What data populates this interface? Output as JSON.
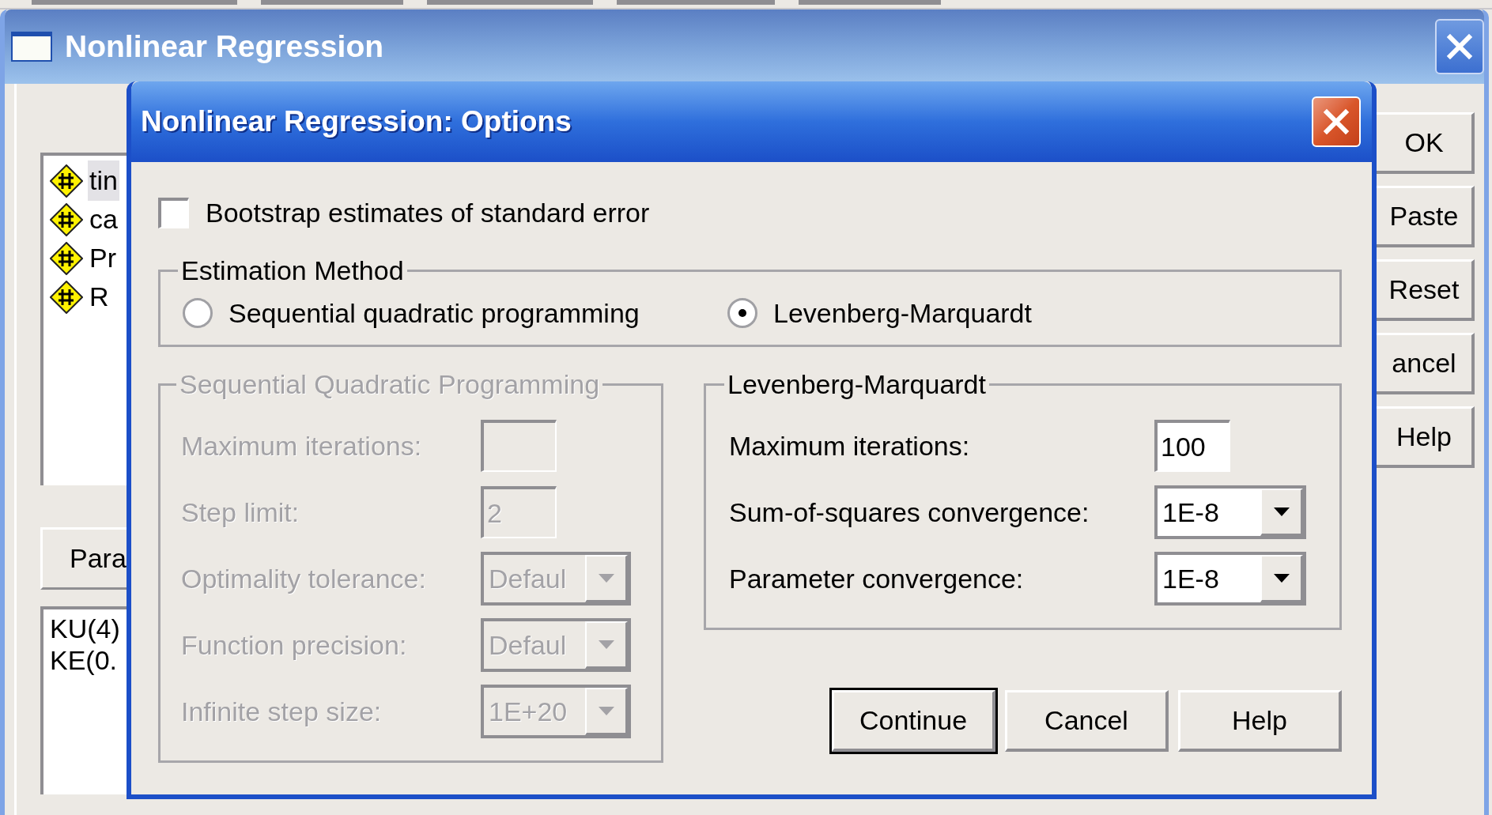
{
  "background_window": {
    "title": "Nonlinear Regression",
    "variables": [
      {
        "label": "tin",
        "selected": true
      },
      {
        "label": "ca",
        "selected": false
      },
      {
        "label": "Pr",
        "selected": false
      },
      {
        "label": "R",
        "selected": false
      }
    ],
    "parameters_button": "Para",
    "parameters": [
      "KU(4)",
      "KE(0."
    ],
    "buttons": [
      "OK",
      "Paste",
      "Reset",
      "ancel",
      "Help"
    ]
  },
  "dialog": {
    "title": "Nonlinear Regression: Options",
    "bootstrap": {
      "label": "Bootstrap estimates of standard error",
      "checked": false
    },
    "estimation_method": {
      "title": "Estimation Method",
      "options": [
        {
          "label": "Sequential quadratic programming",
          "selected": false
        },
        {
          "label": "Levenberg-Marquardt",
          "selected": true
        }
      ]
    },
    "sqp": {
      "title": "Sequential Quadratic Programming",
      "disabled": true,
      "fields": [
        {
          "kind": "text",
          "label": "Maximum iterations:"
        },
        {
          "kind": "text",
          "label": "Step limit:",
          "value": "2"
        },
        {
          "kind": "combo",
          "label": "Optimality tolerance:",
          "value": "Defaul"
        },
        {
          "kind": "combo",
          "label": "Function precision:",
          "value": "Defaul"
        },
        {
          "kind": "combo",
          "label": "Infinite step size:",
          "value": "1E+20"
        }
      ]
    },
    "lm": {
      "title": "Levenberg-Marquardt",
      "disabled": false,
      "fields": [
        {
          "kind": "text",
          "label": "Maximum iterations:",
          "value": "100"
        },
        {
          "kind": "combo",
          "label": "Sum-of-squares convergence:",
          "value": "1E-8"
        },
        {
          "kind": "combo",
          "label": "Parameter convergence:",
          "value": "1E-8"
        }
      ]
    },
    "buttons": [
      {
        "label": "Continue",
        "default": true
      },
      {
        "label": "Cancel",
        "default": false
      },
      {
        "label": "Help",
        "default": false
      }
    ]
  }
}
